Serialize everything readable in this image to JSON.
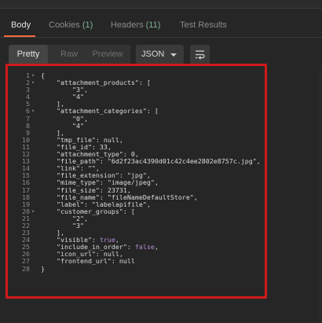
{
  "tabs": {
    "body": "Body",
    "cookies": "Cookies",
    "cookies_count": "(1)",
    "headers": "Headers",
    "headers_count": "(11)",
    "test_results": "Test Results"
  },
  "toolbar": {
    "pretty": "Pretty",
    "raw": "Raw",
    "preview": "Preview",
    "format": "JSON"
  },
  "editor": {
    "lines": [
      "{",
      "    \"attachment_products\": [",
      "        \"3\",",
      "        \"4\"",
      "    ],",
      "    \"attachment_categories\": [",
      "        \"0\",",
      "        \"4\"",
      "    ],",
      "    \"tmp_file\": null,",
      "    \"file_id\": 33,",
      "    \"attachment_type\": 0,",
      "    \"file_path\": \"6d2f23ac4390d01c42c4ee2802e8757c.jpg\",",
      "    \"link\": \"\",",
      "    \"file_extension\": \"jpg\",",
      "    \"mime_type\": \"image/jpeg\",",
      "    \"file_size\": 23731,",
      "    \"file_name\": \"fileNameDefaultStore\",",
      "    \"label\": \"labelapifile\",",
      "    \"customer_groups\": [",
      "        \"2\",",
      "        \"3\"",
      "    ],",
      "    \"visible\": true,",
      "    \"include_in_order\": false,",
      "    \"icon_url\": null,",
      "    \"frontend_url\": null",
      "}"
    ],
    "line_numbers": [
      "1",
      "2",
      "3",
      "4",
      "5",
      "6",
      "7",
      "8",
      "9",
      "10",
      "11",
      "12",
      "13",
      "14",
      "15",
      "16",
      "17",
      "18",
      "19",
      "20",
      "21",
      "22",
      "23",
      "24",
      "25",
      "26",
      "27",
      "28"
    ],
    "foldable_lines": [
      1,
      2,
      6,
      20
    ]
  },
  "colors": {
    "accent": "#f26b3a",
    "highlight": "#d11a1a",
    "count": "#7bb38f",
    "boolean": "#b88bd6"
  }
}
